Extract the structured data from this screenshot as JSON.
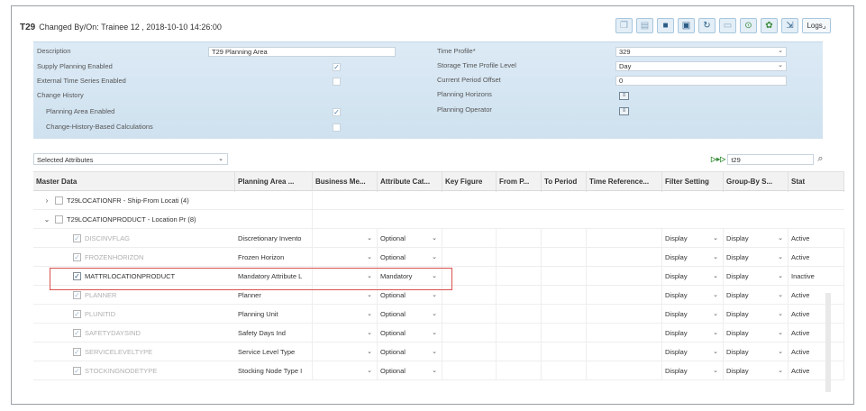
{
  "title": {
    "code": "T29",
    "changed": "Changed By/On: Trainee 12 , 2018-10-10 14:26:00"
  },
  "toolbar": {
    "logs_label": "Logs"
  },
  "header": {
    "left": [
      {
        "label": "Description",
        "value": "T29 Planning Area"
      },
      {
        "label": "Supply Planning Enabled",
        "checked": "✓"
      },
      {
        "label": "External Time Series Enabled",
        "checked": ""
      },
      {
        "label": "Change History"
      },
      {
        "label": "Planning Area Enabled",
        "checked": "✓"
      },
      {
        "label": "Change-History-Based Calculations",
        "checked": ""
      }
    ],
    "right": [
      {
        "label": "Time Profile*",
        "value": "329"
      },
      {
        "label": "Storage Time Profile Level",
        "value": "Day"
      },
      {
        "label": "Current Period Offset",
        "value": "0"
      },
      {
        "label": "Planning Horizons"
      },
      {
        "label": "Planning Operator"
      }
    ]
  },
  "filter": {
    "selected": "Selected Attributes",
    "search_value": "t29"
  },
  "columns": [
    "Master Data",
    "Planning Area ...",
    "Business Me...",
    "Attribute Cat...",
    "Key Figure",
    "From P...",
    "To Period",
    "Time Reference...",
    "Filter Setting",
    "Group-By S...",
    "Stat"
  ],
  "groups": [
    {
      "name": "T29LOCATIONFR - Ship-From Locati (4)",
      "chevron": "›"
    },
    {
      "name": "T29LOCATIONPRODUCT - Location Pr (8)",
      "chevron": "⌄"
    }
  ],
  "rows": [
    {
      "attr": "DISCINVFLAG",
      "planning": "Discretionary Invento",
      "category": "Optional",
      "filter": "Display",
      "groupby": "Display",
      "status": "Active",
      "checked": "✓",
      "muted": true
    },
    {
      "attr": "FROZENHORIZON",
      "planning": "Frozen Horizon",
      "category": "Optional",
      "filter": "Display",
      "groupby": "Display",
      "status": "Active",
      "checked": "✓",
      "muted": true
    },
    {
      "attr": "MATTRLOCATIONPRODUCT",
      "planning": "Mandatory Attribute L",
      "category": "Mandatory",
      "filter": "Display",
      "groupby": "Display",
      "status": "Inactive",
      "checked": "✓",
      "muted": false
    },
    {
      "attr": "PLANNER",
      "planning": "Planner",
      "category": "Optional",
      "filter": "Display",
      "groupby": "Display",
      "status": "Active",
      "checked": "✓",
      "muted": true
    },
    {
      "attr": "PLUNITID",
      "planning": "Planning Unit",
      "category": "Optional",
      "filter": "Display",
      "groupby": "Display",
      "status": "Active",
      "checked": "✓",
      "muted": true
    },
    {
      "attr": "SAFETYDAYSIND",
      "planning": "Safety Days Ind",
      "category": "Optional",
      "filter": "Display",
      "groupby": "Display",
      "status": "Active",
      "checked": "✓",
      "muted": true
    },
    {
      "attr": "SERVICELEVELTYPE",
      "planning": "Service Level Type",
      "category": "Optional",
      "filter": "Display",
      "groupby": "Display",
      "status": "Active",
      "checked": "✓",
      "muted": true
    },
    {
      "attr": "STOCKINGNODETYPE",
      "planning": "Stocking Node Type I",
      "category": "Optional",
      "filter": "Display",
      "groupby": "Display",
      "status": "Active",
      "checked": "✓",
      "muted": true
    }
  ],
  "colors": {
    "header_bg": "#d5e6f2",
    "highlight": "#d9534f",
    "accent": "#2b5d86"
  }
}
